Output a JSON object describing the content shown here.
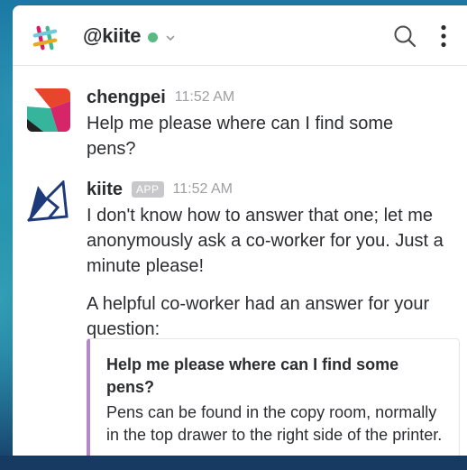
{
  "header": {
    "channel_name": "@kiite",
    "presence_color": "#5bb982",
    "icons": [
      "slack-logo-icon",
      "chevron-down-icon",
      "search-icon",
      "more-vertical-icon"
    ]
  },
  "messages": [
    {
      "author": "chengpei",
      "time": "11:52 AM",
      "text": "Help me please where can I find some pens?"
    },
    {
      "author": "kiite",
      "badge": "APP",
      "time": "11:52 AM",
      "text": "I don't know how to answer that one; let me anonymously ask a co-worker for you. Just a minute please!",
      "followup": "A helpful co-worker had an answer for your question:",
      "attachment": {
        "title": "Help me please where can I find some pens?",
        "text": "Pens can be found in the copy room, normally in the top drawer to the right side of the printer.",
        "accent_color": "#b389c7"
      }
    }
  ]
}
